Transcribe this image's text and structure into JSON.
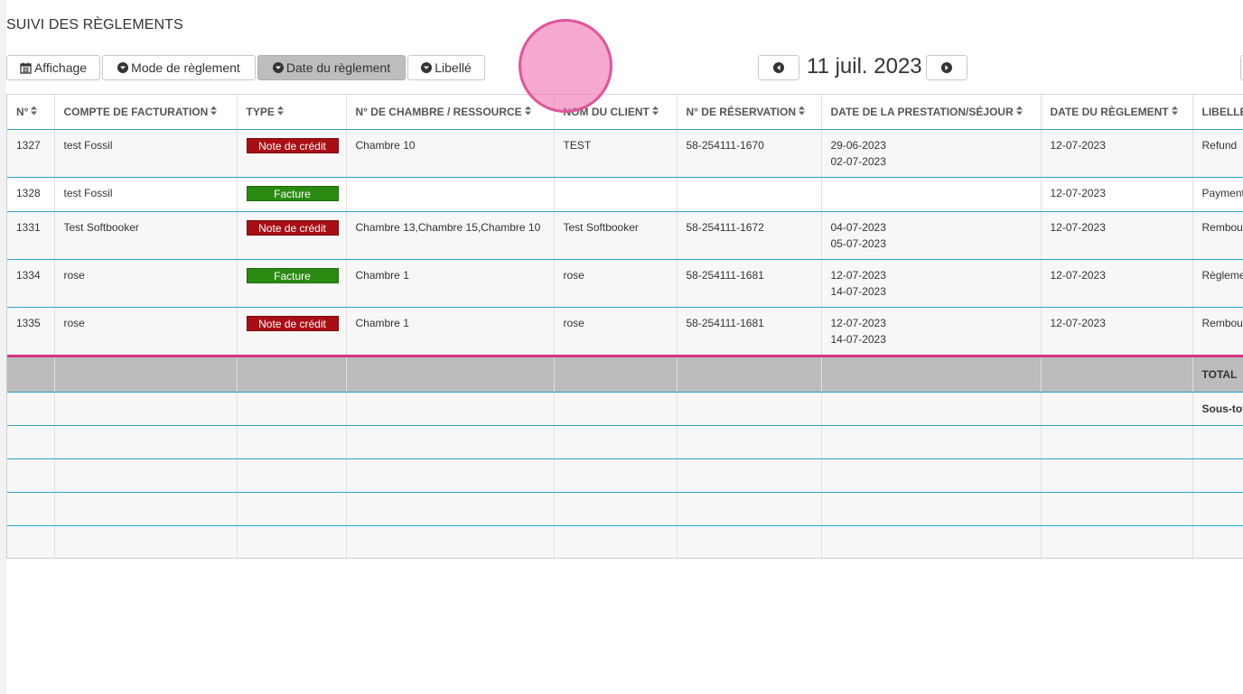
{
  "page": {
    "title": "SUIVI DES RÈGLEMENTS"
  },
  "toolbar": {
    "affichage": "Affichage",
    "mode_reglement": "Mode de règlement",
    "date_reglement": "Date du règlement",
    "libelle": "Libellé"
  },
  "date_nav": {
    "current": "11 juil. 2023"
  },
  "table": {
    "headers": [
      "N°",
      "COMPTE DE FACTURATION",
      "TYPE",
      "N° DE CHAMBRE / RESSOURCE",
      "NOM DU CLIENT",
      "N° DE RÉSERVATION",
      "DATE DE LA PRESTATION/SÉJOUR",
      "DATE DU RÈGLEMENT",
      "LIBELLÉ"
    ],
    "rows": [
      {
        "num": "1327",
        "account": "test Fossil",
        "type": "Note de crédit",
        "room": "Chambre 10",
        "client": "TEST",
        "reservation": "58-254111-1670",
        "date_from": "29-06-2023",
        "date_to": "02-07-2023",
        "payment_date": "12-07-2023",
        "label": "Refund"
      },
      {
        "num": "1328",
        "account": "test Fossil",
        "type": "Facture",
        "room": "",
        "client": "",
        "reservation": "",
        "date_from": "",
        "date_to": "",
        "payment_date": "12-07-2023",
        "label": "Payment"
      },
      {
        "num": "1331",
        "account": "Test Softbooker",
        "type": "Note de crédit",
        "room": "Chambre 13,Chambre 15,Chambre 10",
        "client": "Test Softbooker",
        "reservation": "58-254111-1672",
        "date_from": "04-07-2023",
        "date_to": "05-07-2023",
        "payment_date": "12-07-2023",
        "label": "Rembour"
      },
      {
        "num": "1334",
        "account": "rose",
        "type": "Facture",
        "room": "Chambre 1",
        "client": "rose",
        "reservation": "58-254111-1681",
        "date_from": "12-07-2023",
        "date_to": "14-07-2023",
        "payment_date": "12-07-2023",
        "label": "Règleme"
      },
      {
        "num": "1335",
        "account": "rose",
        "type": "Note de crédit",
        "room": "Chambre 1",
        "client": "rose",
        "reservation": "58-254111-1681",
        "date_from": "12-07-2023",
        "date_to": "14-07-2023",
        "payment_date": "12-07-2023",
        "label": "Rembour"
      }
    ],
    "total_label": "TOTAL",
    "subtotal_label": "Sous-tot"
  },
  "colors": {
    "credit": "#a80f14",
    "facture": "#2b8a12",
    "row_border": "#2fa3c9",
    "total_border": "#d4357e"
  }
}
